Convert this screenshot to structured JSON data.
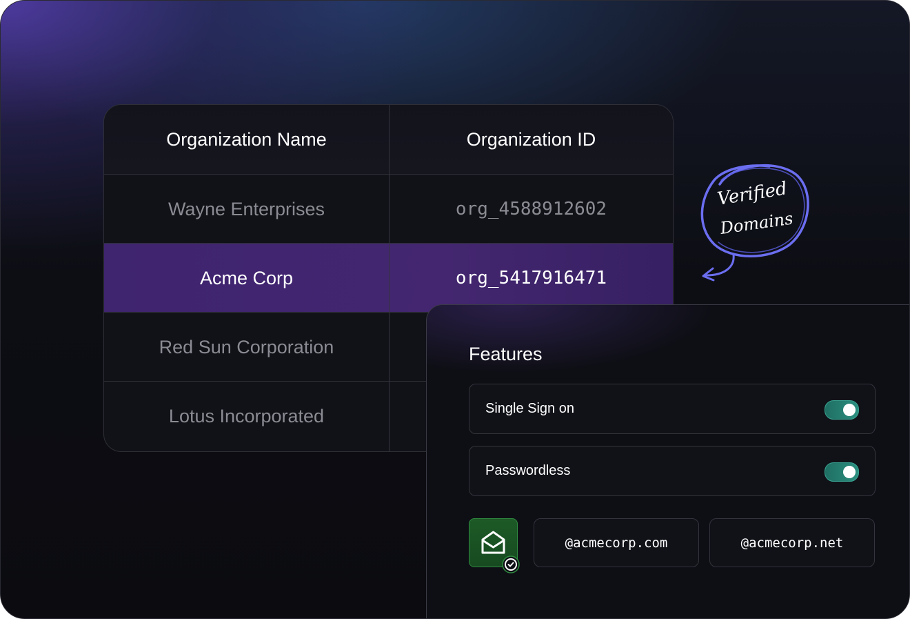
{
  "table": {
    "headers": [
      "Organization Name",
      "Organization ID"
    ],
    "rows": [
      {
        "name": "Wayne Enterprises",
        "id": "org_4588912602"
      },
      {
        "name": "Acme Corp",
        "id": "org_5417916471",
        "selected": true
      },
      {
        "name": "Red Sun Corporation",
        "id": ""
      },
      {
        "name": "Lotus Incorporated",
        "id": ""
      }
    ]
  },
  "callout": {
    "line1": "Verified",
    "line2": "Domains",
    "color": "#6b6ef0"
  },
  "features": {
    "title": "Features",
    "toggles": [
      {
        "label": "Single Sign on",
        "on": true
      },
      {
        "label": "Passwordless",
        "on": true
      }
    ],
    "verified_icon": "envelope-open-icon",
    "domains": [
      "@acmecorp.com",
      "@acmecorp.net"
    ]
  },
  "colors": {
    "selected_row": "#43266f",
    "toggle_on": "#2b8f7f",
    "verified_green": "#1d5a27"
  }
}
